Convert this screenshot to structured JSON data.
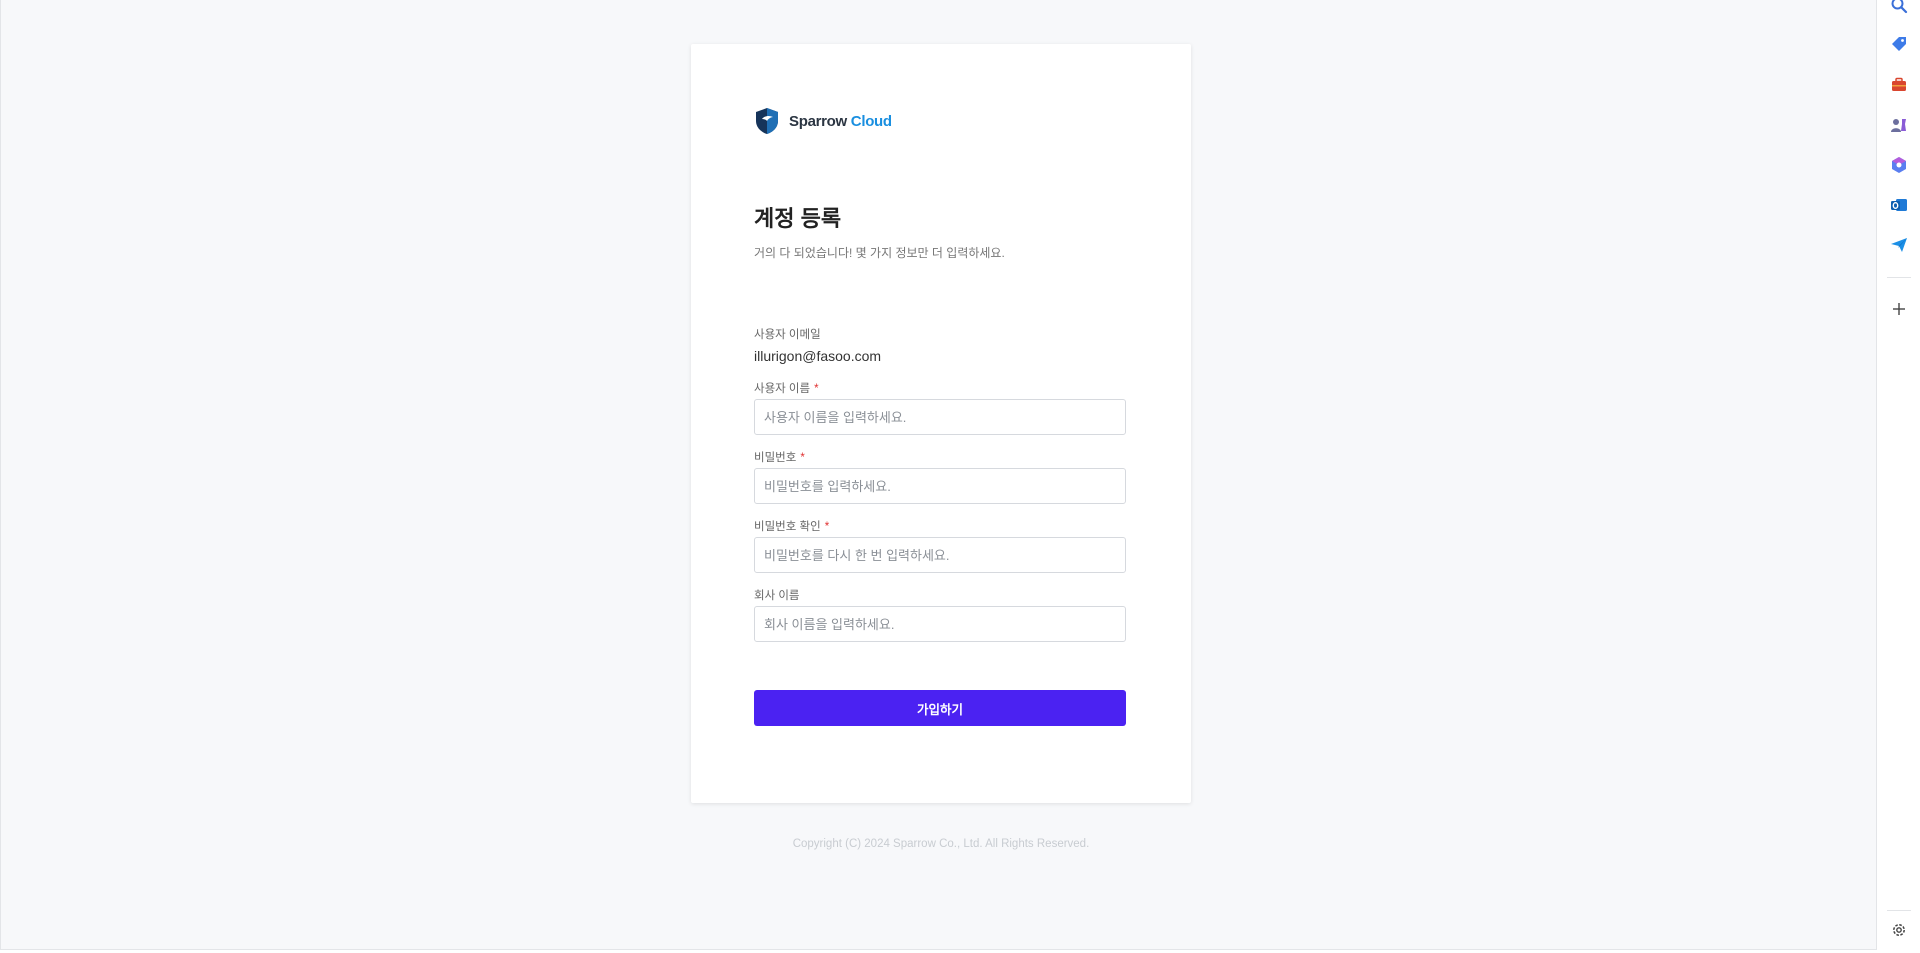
{
  "brand": {
    "name_part1": "Sparrow",
    "name_part2": "Cloud",
    "logo_icon": "shield-logo-icon"
  },
  "form": {
    "title": "계정 등록",
    "subtitle": "거의 다 되었습니다! 몇 가지 정보만 더 입력하세요.",
    "email_label": "사용자 이메일",
    "email_value": "illurigon@fasoo.com",
    "username_label": "사용자 이름",
    "username_placeholder": "사용자 이름을 입력하세요.",
    "password_label": "비밀번호",
    "password_placeholder": "비밀번호를 입력하세요.",
    "password_confirm_label": "비밀번호 확인",
    "password_confirm_placeholder": "비밀번호를 다시 한 번 입력하세요.",
    "company_label": "회사 이름",
    "company_placeholder": "회사 이름을 입력하세요.",
    "required_mark": "*",
    "submit_label": "가입하기"
  },
  "footer": {
    "copyright": "Copyright (C) 2024 Sparrow Co., Ltd. All Rights Reserved."
  },
  "sidebar": {
    "items": [
      {
        "name": "search-icon"
      },
      {
        "name": "tag-icon"
      },
      {
        "name": "briefcase-icon"
      },
      {
        "name": "people-chess-icon"
      },
      {
        "name": "copilot-icon"
      },
      {
        "name": "outlook-icon"
      },
      {
        "name": "send-icon"
      },
      {
        "name": "add-icon"
      },
      {
        "name": "settings-icon"
      }
    ]
  },
  "colors": {
    "accent": "#4b22f2",
    "brand_blue": "#1a8fe0",
    "required": "#e03131"
  }
}
